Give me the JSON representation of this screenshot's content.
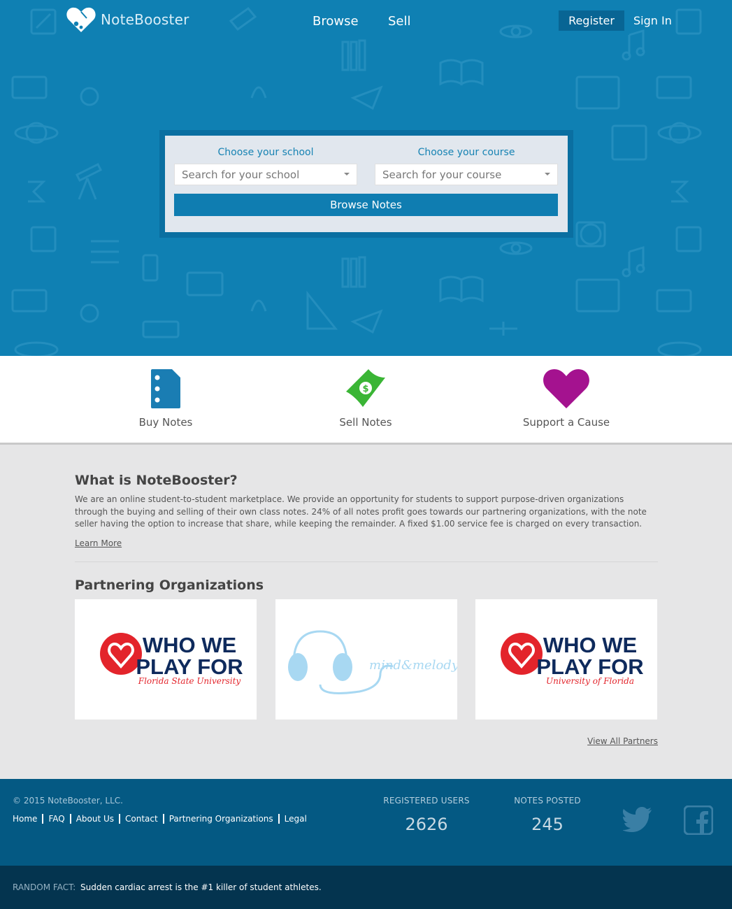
{
  "brand": {
    "name": "NoteBooster",
    "logo_icon": "heart-tag-icon"
  },
  "nav": {
    "browse": "Browse",
    "sell": "Sell",
    "register": "Register",
    "sign_in": "Sign In"
  },
  "search": {
    "school_label": "Choose your school",
    "school_placeholder": "Search for your school",
    "course_label": "Choose your course",
    "course_placeholder": "Search for your course",
    "button": "Browse Notes"
  },
  "features": [
    {
      "label": "Buy Notes",
      "icon": "notebook-icon",
      "color": "#1a7db3"
    },
    {
      "label": "Sell Notes",
      "icon": "money-bill-icon",
      "color": "#3ab535"
    },
    {
      "label": "Support a Cause",
      "icon": "heart-icon",
      "color": "#a4128f"
    }
  ],
  "about": {
    "title": "What is NoteBooster?",
    "text": "We are an online student-to-student marketplace. We provide an opportunity for students to support purpose-driven organizations through the buying and selling of their own class notes. 24% of all notes profit goes towards our partnering organizations, with the note seller having the option to increase that share, while keeping the remainder. A fixed $1.00 service fee is charged on every transaction.",
    "learn_more": "Learn More"
  },
  "partners": {
    "title": "Partnering Organizations",
    "view_all": "View All Partners",
    "items": [
      {
        "line1": "WHO WE",
        "line2": "PLAY FOR",
        "sub": "Florida State University"
      },
      {
        "wordmark": "mind&melody"
      },
      {
        "line1": "WHO WE",
        "line2": "PLAY FOR",
        "sub": "University of Florida"
      }
    ]
  },
  "footer": {
    "copyright": "© 2015 NoteBooster, LLC.",
    "links": [
      "Home",
      "FAQ",
      "About Us",
      "Contact",
      "Partnering Organizations",
      "Legal"
    ],
    "stats": [
      {
        "label": "REGISTERED USERS",
        "value": "2626"
      },
      {
        "label": "NOTES POSTED",
        "value": "245"
      }
    ],
    "social": [
      "twitter-icon",
      "facebook-icon"
    ]
  },
  "fact": {
    "label": "RANDOM FACT:",
    "text": "Sudden cardiac arrest is the #1 killer of student athletes."
  },
  "colors": {
    "hero": "#0f80b3",
    "register": "#086594",
    "footer": "#045983",
    "factbar": "#04344f"
  }
}
